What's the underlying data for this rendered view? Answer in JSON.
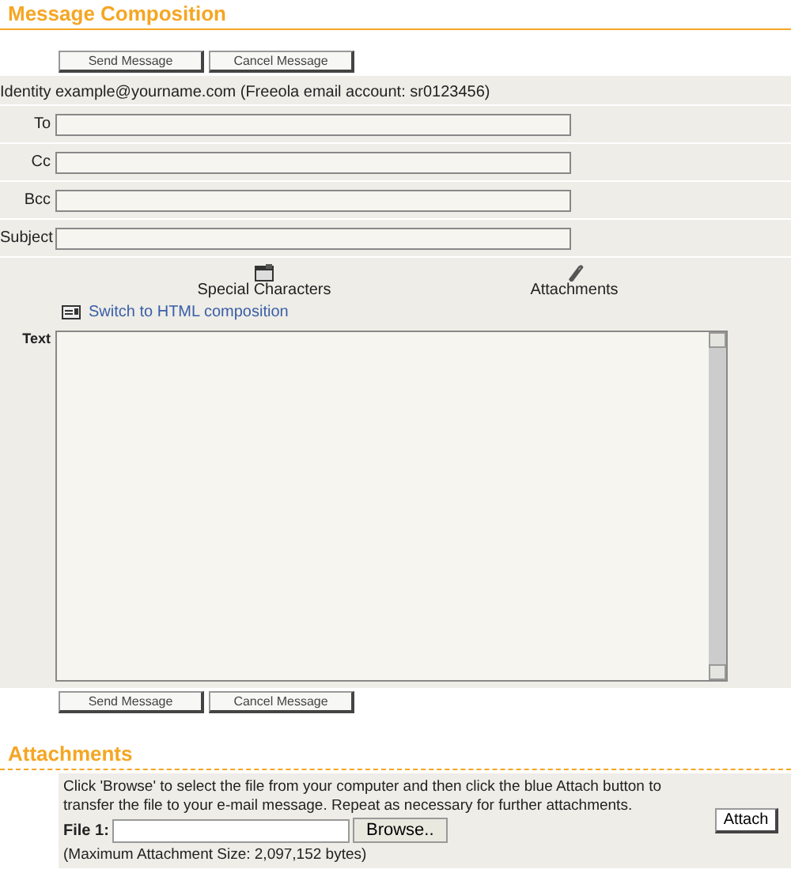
{
  "compose": {
    "title": "Message Composition",
    "top_buttons": [
      "Send Message",
      "Cancel Message"
    ],
    "identity": {
      "label": "Identity",
      "value": "example@yourname.com  (Freeola email account: sr0123456)"
    },
    "fields": [
      {
        "label": "To"
      },
      {
        "label": "Cc"
      },
      {
        "label": "Bcc"
      },
      {
        "label": "Subject"
      }
    ],
    "tools": [
      {
        "kind": "characters",
        "label": "Special Characters"
      },
      {
        "kind": "attach",
        "label": "Attachments"
      }
    ],
    "html_link": "Switch to HTML composition",
    "text_label": "Text",
    "bottom_buttons": [
      "Send Message",
      "Cancel Message"
    ]
  },
  "attachments": {
    "title": "Attachments",
    "instructions": "Click 'Browse' to select the file from your computer and then click the blue Attach button to transfer the file to your e-mail message. Repeat as necessary for further attachments.",
    "file_label": "File 1:",
    "browse": "Browse..",
    "attach": "Attach",
    "max_size": "(Maximum Attachment Size: 2,097,152 bytes)"
  }
}
